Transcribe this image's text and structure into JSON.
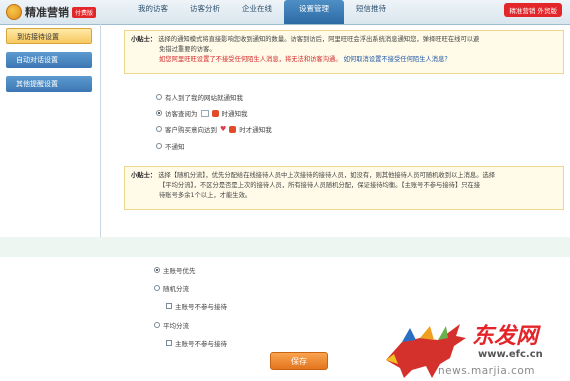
{
  "app": {
    "logo_text": "精准营销",
    "logo_badge": "付费版",
    "user_badge": "精准营销 外贸版"
  },
  "nav": {
    "tabs": [
      {
        "label": "我的访客"
      },
      {
        "label": "访客分析"
      },
      {
        "label": "企业在线"
      },
      {
        "label": "设置管理"
      },
      {
        "label": "短信推待"
      }
    ],
    "active_index": 3
  },
  "sidebar": {
    "items": [
      {
        "label": "到访接待设置"
      },
      {
        "label": "自动对话设置"
      },
      {
        "label": "其他提醒设置"
      }
    ]
  },
  "tip1": {
    "label": "小贴士：",
    "line1": "选择的通知模式将直接影响您收到通知的数量。访客到访后，阿里旺旺会浮出系统消息通知您，弹择旺旺在线可以避",
    "line2": "免错过重要的访客。",
    "red_text": "如您阿里旺旺设置了不接受任何陌生人消息，将无法和访客沟通。",
    "blue_link": "如何取消设置不接受任何陌生人消息？"
  },
  "notify_options": [
    {
      "label": "有人到了我的网站就通知我",
      "selected": false
    },
    {
      "label_pre": "访客查阅为",
      "label_post": "时通知我",
      "selected": true
    },
    {
      "label_pre": "客户购买意向达到",
      "label_post": "时才通知我",
      "selected": false
    },
    {
      "label": "不通知",
      "selected": false
    }
  ],
  "tip2": {
    "label": "小贴士：",
    "line1": "选择【随机分流】，优先分配给在线接待人员中上次接待的接待人员，如没有，则其他接待人员可随机收到以上消息。选择",
    "line2": "【平均分流】，不区分是否是上次的接待人员，所有接待人员随机分配，保证接待均衡。【主账号不参与接待】只在接",
    "line3": "待账号多余1个以上，才能生效。"
  },
  "dist_options": {
    "primary": "主账号优先",
    "random": "随机分流",
    "random_check": "主账号不参与接待",
    "average": "平均分流",
    "average_check": "主账号不参与接待",
    "selected": "primary"
  },
  "save_label": "保存",
  "watermark": {
    "brand": "东发网",
    "url1": "www.efc.cn",
    "url2": "news.marjia.com"
  }
}
